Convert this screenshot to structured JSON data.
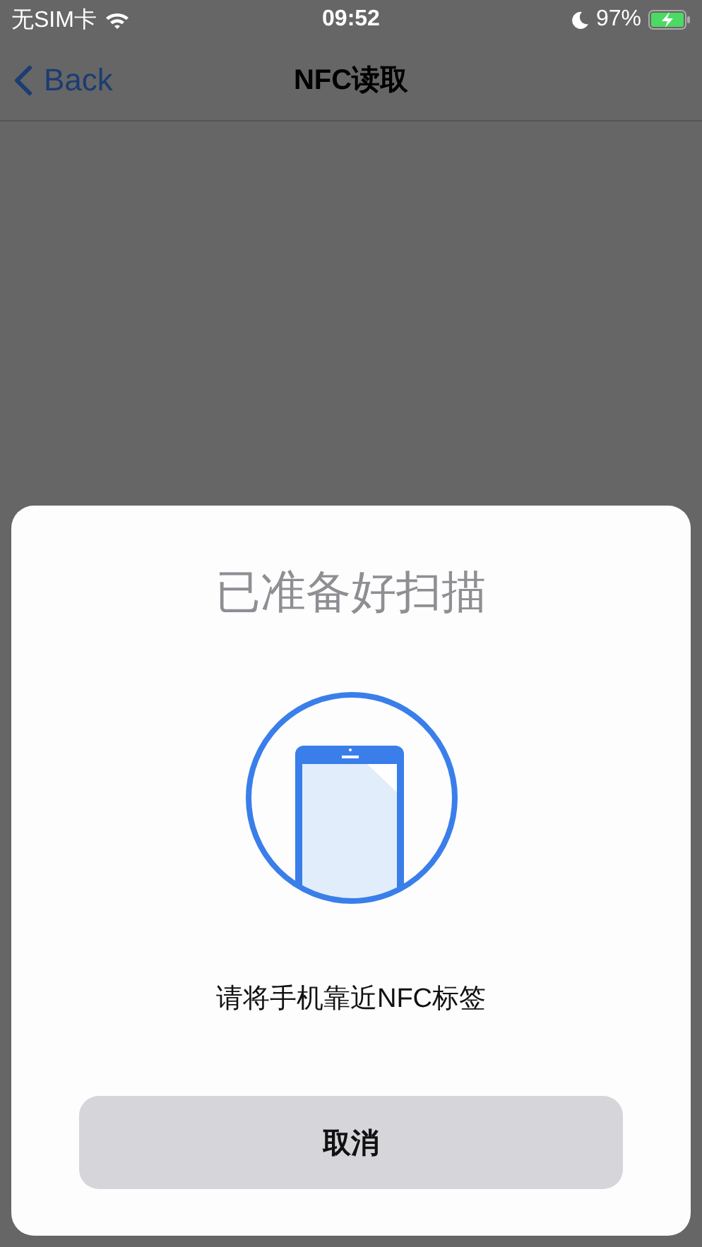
{
  "status_bar": {
    "carrier": "无SIM卡",
    "time": "09:52",
    "battery": "97%"
  },
  "nav_bar": {
    "back": "Back",
    "title": "NFC读取"
  },
  "sheet": {
    "title": "已准备好扫描",
    "message": "请将手机靠近NFC标签",
    "button": "取消"
  }
}
